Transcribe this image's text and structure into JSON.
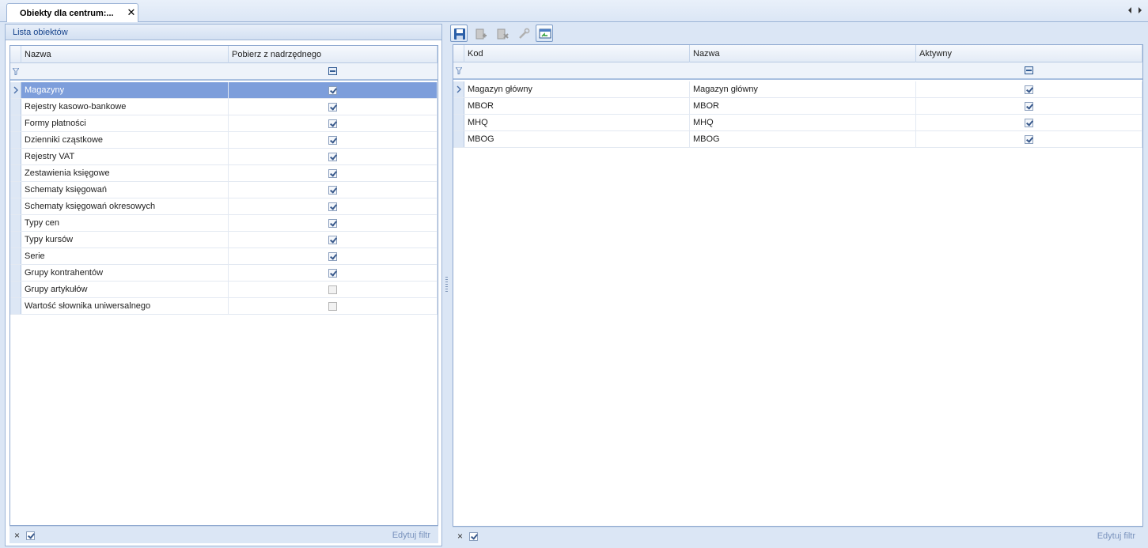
{
  "tab": {
    "label": "Obiekty dla centrum:..."
  },
  "left": {
    "title": "Lista obiektów",
    "columns": [
      "Nazwa",
      "Pobierz z nadrzędnego"
    ],
    "rows": [
      {
        "name": "Magazyny",
        "checked": true
      },
      {
        "name": "Rejestry kasowo-bankowe",
        "checked": true
      },
      {
        "name": "Formy płatności",
        "checked": true
      },
      {
        "name": "Dzienniki cząstkowe",
        "checked": true
      },
      {
        "name": "Rejestry VAT",
        "checked": true
      },
      {
        "name": "Zestawienia księgowe",
        "checked": true
      },
      {
        "name": "Schematy księgowań",
        "checked": true
      },
      {
        "name": "Schematy księgowań okresowych",
        "checked": true
      },
      {
        "name": "Typy cen",
        "checked": true
      },
      {
        "name": "Typy kursów",
        "checked": true
      },
      {
        "name": "Serie",
        "checked": true
      },
      {
        "name": "Grupy kontrahentów",
        "checked": true
      },
      {
        "name": "Grupy artykułów",
        "checked": false
      },
      {
        "name": "Wartość słownika uniwersalnego",
        "checked": false
      }
    ],
    "footer": {
      "close": "×",
      "edit_filter": "Edytuj filtr"
    }
  },
  "right": {
    "toolbar": [
      "save-icon",
      "add-icon",
      "remove-icon",
      "wrench-icon",
      "refresh-view-icon"
    ],
    "columns": [
      "Kod",
      "Nazwa",
      "Aktywny"
    ],
    "rows": [
      {
        "kod": "Magazyn główny",
        "nazwa": "Magazyn główny",
        "aktywny": true
      },
      {
        "kod": "MBOR",
        "nazwa": "MBOR",
        "aktywny": true
      },
      {
        "kod": "MHQ",
        "nazwa": "MHQ",
        "aktywny": true
      },
      {
        "kod": "MBOG",
        "nazwa": "MBOG",
        "aktywny": true
      }
    ],
    "footer": {
      "close": "×",
      "edit_filter": "Edytuj filtr"
    }
  },
  "colors": {
    "selected_row": "#7d9edb",
    "header_text": "#15428b",
    "workspace": "#dbe6f5"
  }
}
